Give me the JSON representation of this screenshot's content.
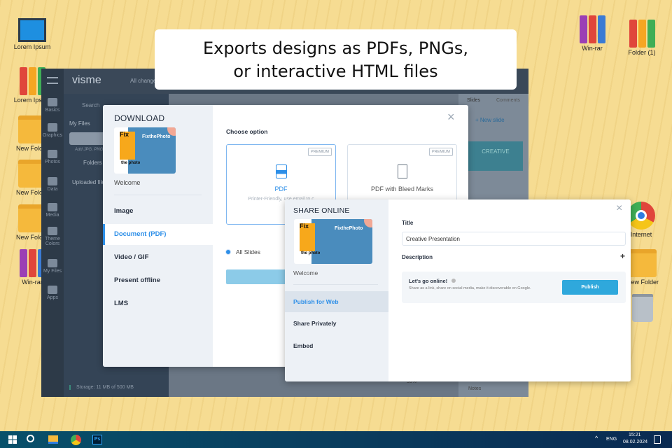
{
  "caption": {
    "line1": "Exports designs as PDFs, PNGs,",
    "line2": "or interactive HTML files"
  },
  "desktop": {
    "left": [
      {
        "label": "Lorem Ipsum",
        "icon": "computer-icon"
      },
      {
        "label": "Lorem Ipsum",
        "icon": "binders-icon"
      },
      {
        "label": "New Folder",
        "icon": "folder-icon"
      },
      {
        "label": "New Folder",
        "icon": "folder-icon"
      },
      {
        "label": "New Folder",
        "icon": "folder-icon"
      },
      {
        "label": "Win-rar",
        "icon": "winrar-icon"
      }
    ],
    "right": [
      {
        "label": "Win-rar",
        "icon": "winrar-icon"
      },
      {
        "label": "Folder (1)",
        "icon": "binders-icon"
      },
      {
        "label": "Internet",
        "icon": "chrome-icon"
      },
      {
        "label": "New Folder",
        "icon": "folder-icon"
      },
      {
        "label": "",
        "icon": "trash-icon"
      }
    ]
  },
  "app": {
    "logo": "visme",
    "status": "All changes saved",
    "search_placeholder": "Search",
    "my_files": "My Files",
    "upload_hint": "Add JPG, PNG, GIF",
    "folders": "Folders",
    "uploaded": "Uploaded files",
    "storage": "Storage: 11 MB of 500 MB",
    "zoom": "55%",
    "notes": "Notes",
    "tabs": [
      "Slides",
      "Comments"
    ],
    "new_slide": "+ New slide",
    "slide_title": "CREATIVE",
    "sidebar": [
      "Basics",
      "Graphics",
      "Photos",
      "Data",
      "Media",
      "Theme Colors",
      "My Files",
      "Apps"
    ]
  },
  "download": {
    "title": "DOWNLOAD",
    "thumb_brand": "FixthePhoto",
    "thumb_logo": "Fix",
    "thumb_sub": "the photo",
    "slide_name": "Welcome",
    "menu": [
      "Image",
      "Document (PDF)",
      "Video / GIF",
      "Present offline",
      "LMS"
    ],
    "active": 1,
    "choose": "Choose option",
    "options": [
      {
        "badge": "PREMIUM",
        "label": "PDF",
        "desc": "Printer-Friendly, use email to c"
      },
      {
        "badge": "PREMIUM",
        "label": "PDF with Bleed Marks"
      }
    ],
    "radio": "All Slides",
    "close": "×"
  },
  "share": {
    "title": "SHARE ONLINE",
    "slide_name": "Welcome",
    "menu": [
      "Publish for Web",
      "Share Privately",
      "Embed"
    ],
    "active": 0,
    "title_label": "Title",
    "title_value": "Creative Presentation",
    "description_label": "Description",
    "plus": "+",
    "online_title": "Let's go online!",
    "online_desc": "Share as a link, share on social media, make it discoverable on Google.",
    "publish": "Publish",
    "close": "×"
  },
  "taskbar": {
    "lang": "ENG",
    "time": "15:21",
    "date": "08.02.2024",
    "ps": "Ps"
  },
  "colors": {
    "accent": "#2d8fe8",
    "publish": "#2fa8dc",
    "taskbar": "#08506a"
  }
}
